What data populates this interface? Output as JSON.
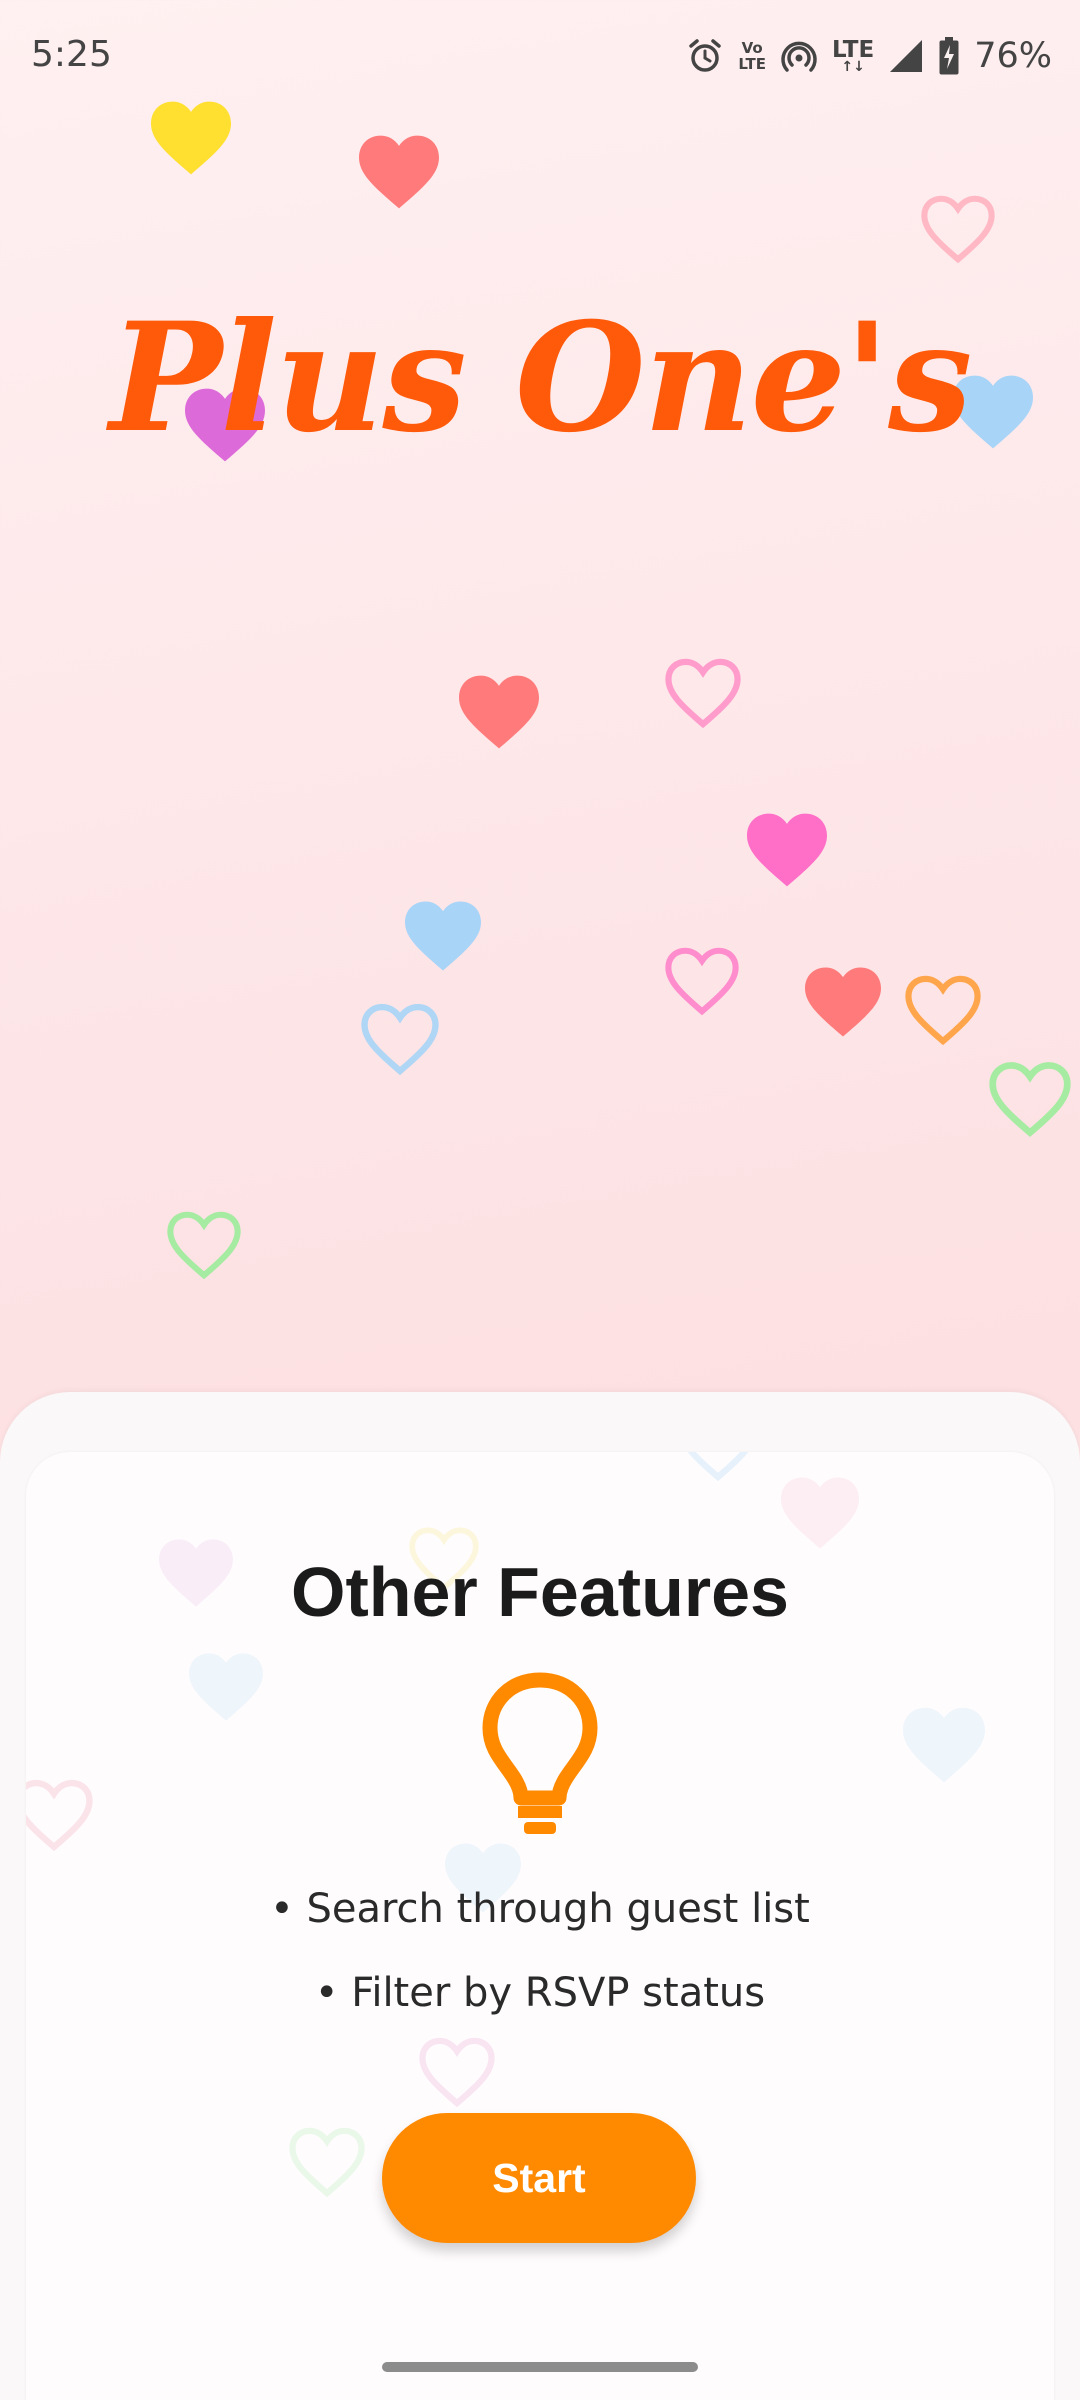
{
  "status_bar": {
    "time": "5:25",
    "battery": "76%",
    "network_badge_top": "Vo",
    "network_badge_bottom": "LTE",
    "lte_label": "LTE",
    "lte_arrows": "↑↓",
    "icons": [
      "alarm-icon",
      "volte-icon",
      "hotspot-icon",
      "lte-icon",
      "signal-icon",
      "battery-charging-icon"
    ]
  },
  "app": {
    "title": "Plus One's"
  },
  "card": {
    "title": "Other Features",
    "icon": "lightbulb-icon",
    "features": [
      "• Search through guest list",
      "• Filter by RSVP status"
    ],
    "start_label": "Start"
  },
  "colors": {
    "title": "#ff5a0a",
    "accent": "#ff8a00",
    "heart_yellow": "#ffdf30",
    "heart_coral": "#ff7b7b",
    "heart_pink": "#ff6fc8",
    "heart_blue": "#a8d4f8",
    "heart_purple": "#dd6ad9",
    "heart_orange": "#ffa64d",
    "heart_green": "#a5eba1"
  }
}
